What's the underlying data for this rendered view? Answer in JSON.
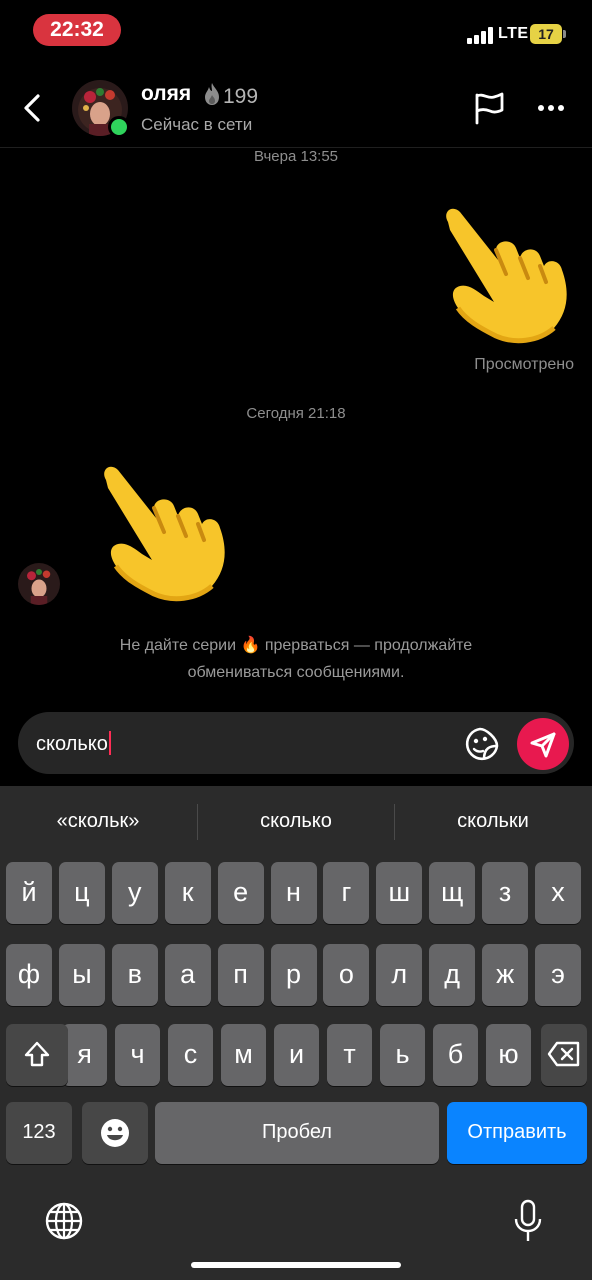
{
  "status_bar": {
    "time": "22:32",
    "network": "LTE",
    "battery": "17"
  },
  "header": {
    "name": "оляя",
    "streak_count": "199",
    "status": "Сейчас в сети"
  },
  "chat": {
    "timestamp_1": "Вчера 13:55",
    "outgoing_emoji": "👇",
    "seen_label": "Просмотрено",
    "timestamp_2": "Сегодня 21:18",
    "incoming_emoji": "👇",
    "streak_hint_line1": "Не дайте серии 🔥 прерваться — продолжайте",
    "streak_hint_line2": "обмениваться сообщениями."
  },
  "composer": {
    "value": "сколько"
  },
  "keyboard": {
    "suggestions": [
      "«скольк»",
      "сколько",
      "скольки"
    ],
    "row1": [
      "й",
      "ц",
      "у",
      "к",
      "е",
      "н",
      "г",
      "ш",
      "щ",
      "з",
      "х"
    ],
    "row2": [
      "ф",
      "ы",
      "в",
      "а",
      "п",
      "р",
      "о",
      "л",
      "д",
      "ж",
      "э"
    ],
    "row3": [
      "я",
      "ч",
      "с",
      "м",
      "и",
      "т",
      "ь",
      "б",
      "ю"
    ],
    "numbers_label": "123",
    "space_label": "Пробел",
    "send_label": "Отправить"
  },
  "icons": {
    "back": "chevron-left-icon",
    "flag": "flag-icon",
    "more": "ellipsis-icon",
    "sticker": "sticker-icon",
    "send": "send-icon",
    "shift": "shift-icon",
    "backspace": "backspace-icon",
    "emoji": "emoji-icon",
    "globe": "globe-icon",
    "mic": "mic-icon"
  },
  "colors": {
    "online": "#2fd35c",
    "send_button": "#e8194f",
    "return_key": "#0a84ff",
    "time_pill": "#d9343f"
  }
}
